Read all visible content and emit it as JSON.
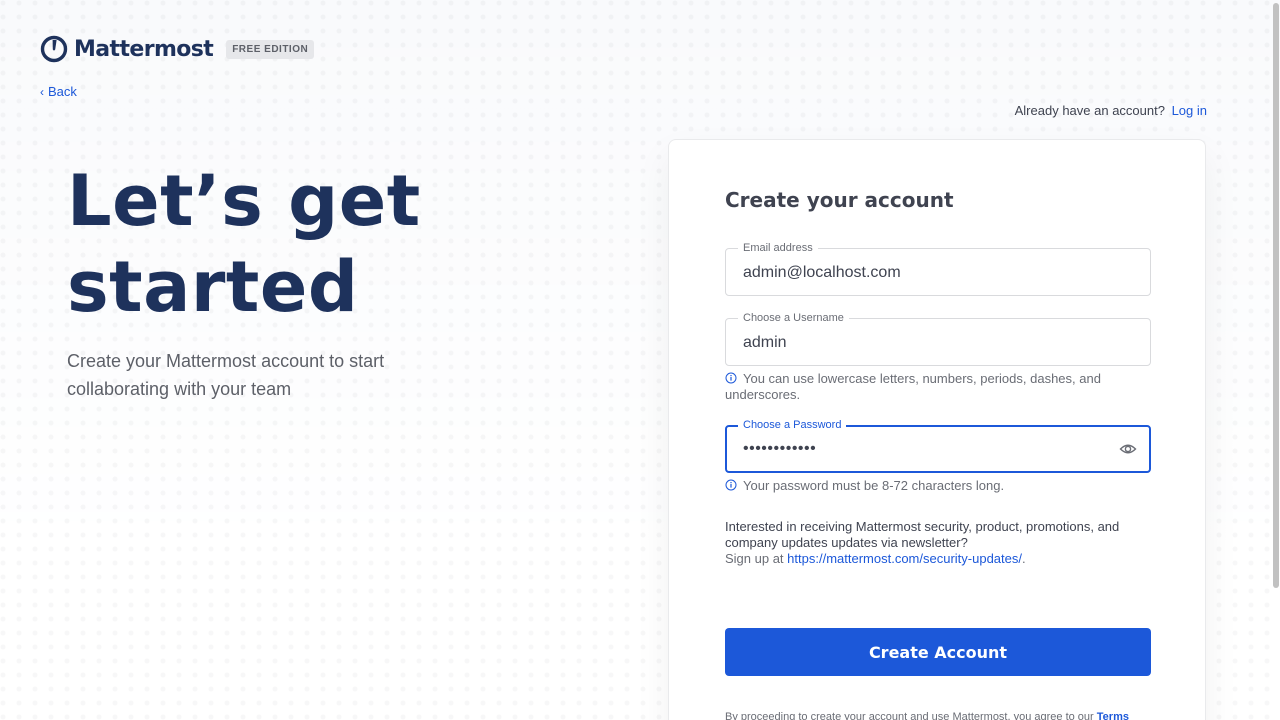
{
  "header": {
    "brand_name": "Mattermost",
    "edition_badge": "FREE EDITION",
    "back_label": "Back",
    "login_prompt": "Already have an account?",
    "login_link": "Log in"
  },
  "hero": {
    "title": "Let’s get started",
    "subtitle": "Create your Mattermost account to start collaborating with your team"
  },
  "form": {
    "title": "Create your account",
    "email": {
      "label": "Email address",
      "value": "admin@localhost.com"
    },
    "username": {
      "label": "Choose a Username",
      "value": "admin",
      "hint": "You can use lowercase letters, numbers, periods, dashes, and underscores."
    },
    "password": {
      "label": "Choose a Password",
      "value": "••••••••••••",
      "hint": "Your password must be 8-72 characters long."
    },
    "newsletter": {
      "text": "Interested in receiving Mattermost security, product, promotions, and company updates updates via newsletter?",
      "signup_prefix": "Sign up at",
      "signup_link": "https://mattermost.com/security-updates/",
      "signup_suffix": "."
    },
    "submit_label": "Create Account",
    "terms": {
      "text": "By proceeding to create your account and use Mattermost, you agree to our",
      "link": "Terms"
    }
  },
  "colors": {
    "brand_navy": "#1e325c",
    "accent_blue": "#1c58d9",
    "text_primary": "#3f4350"
  },
  "icons": {
    "logo": "mattermost-logo-icon",
    "back": "chevron-left-icon",
    "info": "info-circle-icon",
    "eye": "eye-icon"
  }
}
